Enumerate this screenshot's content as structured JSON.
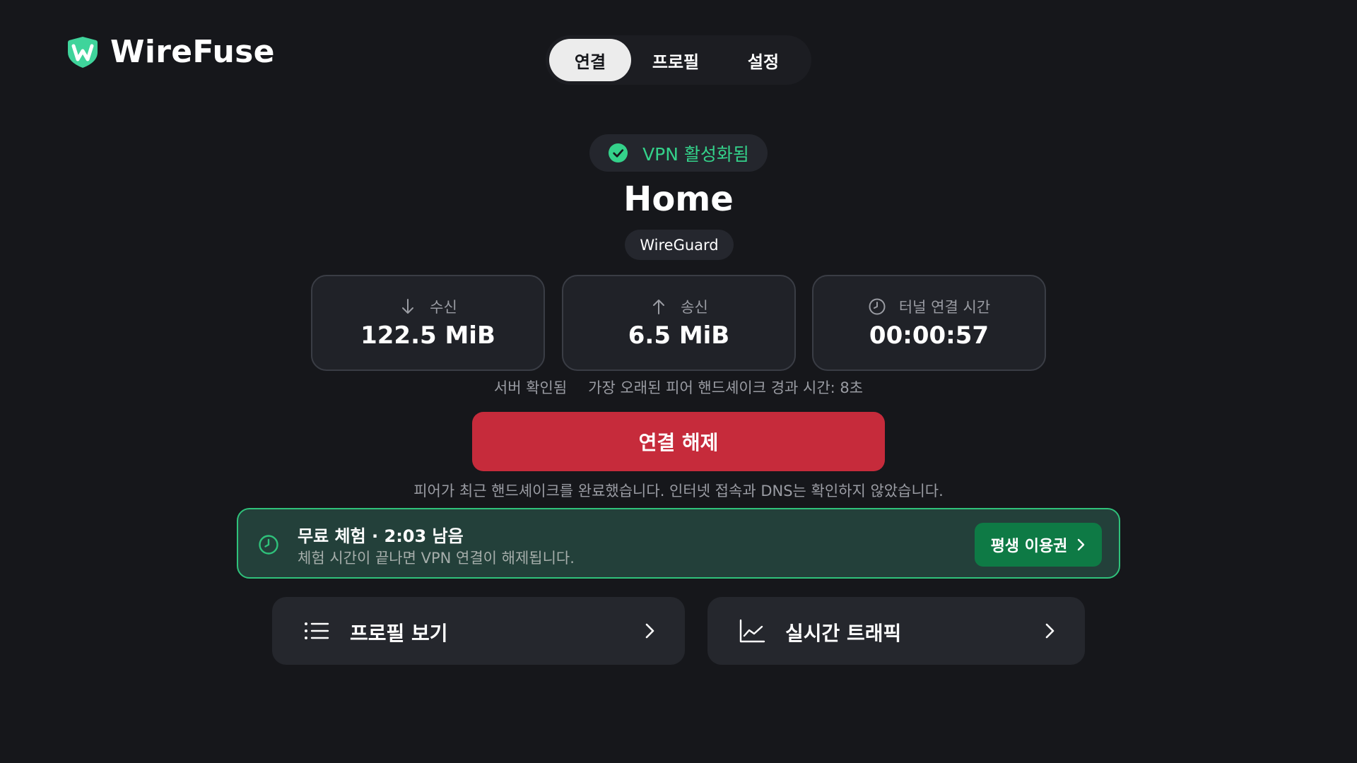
{
  "app": {
    "name": "WireFuse"
  },
  "tabs": [
    {
      "label": "연결",
      "active": true
    },
    {
      "label": "프로필",
      "active": false
    },
    {
      "label": "설정",
      "active": false
    }
  ],
  "status": {
    "text": "VPN 활성화됨",
    "color": "#34d18a"
  },
  "profile": {
    "name": "Home",
    "protocol": "WireGuard"
  },
  "stats": [
    {
      "label": "수신",
      "value": "122.5 MiB",
      "icon": "arrow-down-icon"
    },
    {
      "label": "송신",
      "value": "6.5 MiB",
      "icon": "arrow-up-icon"
    },
    {
      "label": "터널 연결 시간",
      "value": "00:00:57",
      "icon": "clock-icon"
    }
  ],
  "meta": {
    "server": "서버 확인됨",
    "handshake": "가장 오래된 피어 핸드셰이크 경과 시간: 8초"
  },
  "disconnect": {
    "label": "연결 해제",
    "color": "#c62b3b"
  },
  "note": "피어가 최근 핸드셰이크를 완료했습니다. 인터넷 접속과 DNS는 확인하지 않았습니다.",
  "trial": {
    "title": "무료 체험 · 2:03 남음",
    "subtitle": "체험 시간이 끝나면 VPN 연결이 해제됩니다.",
    "button": "평생 이용권",
    "accent": "#2fc27b"
  },
  "nav": [
    {
      "label": "프로필 보기",
      "icon": "list-icon"
    },
    {
      "label": "실시간 트래픽",
      "icon": "line-chart-icon"
    }
  ]
}
